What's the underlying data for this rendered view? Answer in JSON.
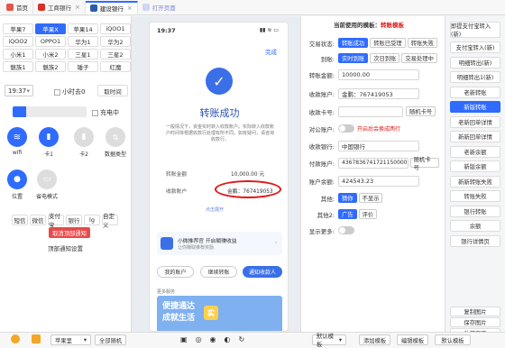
{
  "tabs": [
    {
      "label": "首页",
      "color": "#e5534b",
      "closable": false
    },
    {
      "label": "工商银行",
      "color": "#d93025",
      "closable": true
    },
    {
      "label": "建设银行",
      "color": "#2a5caa",
      "closable": true,
      "active": true
    },
    {
      "label": "打开页面",
      "color": "#cfd6ef",
      "closable": false,
      "faded": true
    }
  ],
  "devices": [
    "苹果7",
    "苹果X",
    "苹果14",
    "iQOO1",
    "iQOO2",
    "OPPO1",
    "华为1",
    "华为2",
    "小米1",
    "小米2",
    "三星1",
    "三星2",
    "魅族1",
    "魅族2",
    "锤子",
    "红魔"
  ],
  "time_label": "19:37",
  "hour_label": "小时去0",
  "time_button": "取时间",
  "charging_label": "充电中",
  "signal": {
    "wifi": "wifi",
    "sim1": "卡1",
    "sim2": "卡2",
    "data_type": "数据类型",
    "location": "位置",
    "power_save": "省电模式"
  },
  "app_buttons": [
    "短信",
    "微信",
    "支付宝",
    "银行",
    "lg",
    "自定义"
  ],
  "cancel_top_button": "取消顶部通知",
  "top_notify_setting": "顶部通知设置",
  "phone": {
    "time": "19:37",
    "done": "完成",
    "title": "转账成功",
    "desc": "一般情况下，资金实时转入收款账户。实际转入收款账户时间将根据收款行处理有所不同。如有疑问，请咨询收款行。",
    "amount_label": "转账金额",
    "amount": "10,000.00 元",
    "account_label": "收款账户",
    "account": "金鹏：767419053",
    "more": "点击展开",
    "banner_title": "小微推荐官 开启躺赚收益",
    "banner_sub": "让你赚取推荐奖励",
    "btn_my": "我的账户",
    "btn_continue": "继续转账",
    "btn_notify": "通知收款人",
    "more_label": "更多服务",
    "ad_line1": "便捷通达",
    "ad_line2": "成就生活",
    "ad_line3": "实"
  },
  "template": {
    "label": "当前使用的模板：",
    "name": "转账模板"
  },
  "form": {
    "status_label": "交易状态:",
    "status_options": [
      "转账成功",
      "转账已受理",
      "转账失败"
    ],
    "arrive_label": "到账:",
    "arrive_options": [
      "实时到账",
      "次日到账",
      "交易处理中"
    ],
    "amount_label": "转账金额:",
    "amount": "10000.00",
    "payee_label": "收款账户:",
    "payee": "金鹏：767419053",
    "card_label": "收款卡号:",
    "card": "",
    "random_card": "随机卡号",
    "public_label": "对公账户:",
    "public_note": "开启后会换成两行",
    "bank_label": "收款银行:",
    "bank": "中国银行",
    "pay_label": "付款账户:",
    "pay": "4367836741721150000",
    "random_pay": "随机卡号",
    "balance_label": "账户余额:",
    "balance": "424543.23",
    "other_label": "其他:",
    "other_options": [
      "猜你",
      "不显示"
    ],
    "other2_label": "其他2:",
    "other2_options": [
      "广告",
      "评价"
    ],
    "show_more_label": "显示更多:"
  },
  "right_buttons": [
    "即提支付宝转入(新)",
    "支付宝转入(新)",
    "明细转出(新)",
    "明细转出1(新)",
    "老新转账",
    "新版转账",
    "老新回单详情",
    "新新回单详情",
    "老新余额",
    "新版余额",
    "新新转账失败",
    "转账失败",
    "银行转账",
    "余额",
    "银行详情页"
  ],
  "right_bottom_buttons": [
    "复制图片",
    "保存图片",
    "收藏页面"
  ],
  "bottom": {
    "phone_model": "苹果里",
    "random_all": "全部随机",
    "default_template": "默认模板",
    "add_template": "添加模板",
    "edit_template": "编辑模板",
    "default_tpl": "默认模板"
  }
}
